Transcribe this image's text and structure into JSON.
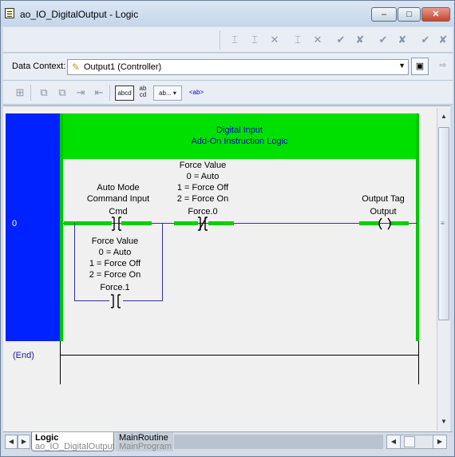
{
  "window": {
    "title": "ao_IO_DigitalOutput - Logic",
    "minimize_glyph": "–",
    "maximize_glyph": "□",
    "close_glyph": "✕"
  },
  "context": {
    "label": "Data Context:",
    "value": "Output1 (Controller)"
  },
  "toolbar2": {
    "text_btn1": "abcd",
    "text_btn2": "ab\ncd",
    "text_btn3": "ab...",
    "text_btn4": "<ab>"
  },
  "ladder": {
    "rung_number": "0",
    "aoi_title": "Digital Input",
    "aoi_subtitle": "Add-On Instruction Logic",
    "xic_desc": [
      "Auto Mode",
      "Command Input"
    ],
    "xic_tag": "Cmd",
    "xio_desc": [
      "Force Value",
      "0 = Auto",
      "1 = Force Off",
      "2 = Force On"
    ],
    "xio_tag": "Force.0",
    "branch_desc": [
      "Force Value",
      "0 = Auto",
      "1 = Force Off",
      "2 = Force On"
    ],
    "branch_tag": "Force.1",
    "ote_desc": "Output Tag",
    "ote_tag": "Output",
    "end_label": "(End)"
  },
  "tabs": [
    {
      "title": "Logic",
      "subtitle": "ao_IO_DigitalOutput"
    },
    {
      "title": "MainRoutine",
      "subtitle": "MainProgram"
    }
  ],
  "colors": {
    "rung_number_bg": "#0022ff",
    "power_rail": "#00c800",
    "aoi_banner": "#00e000",
    "aoi_text": "#0000c0"
  }
}
